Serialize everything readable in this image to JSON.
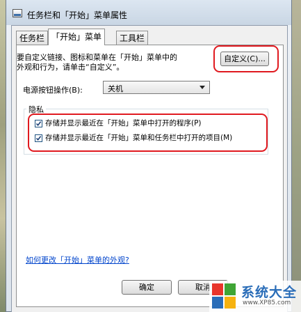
{
  "window": {
    "title": "任务栏和「开始」菜单属性"
  },
  "tabs": [
    {
      "label": "任务栏",
      "active": false
    },
    {
      "label": "「开始」菜单",
      "active": true
    },
    {
      "label": "工具栏",
      "active": false
    }
  ],
  "start_menu": {
    "description_line1": "要自定义链接、图标和菜单在「开始」菜单中的",
    "description_line2": "外观和行为，请单击“自定义”。",
    "customize_button": "自定义(C)...",
    "power_label": "电源按钮操作(B):",
    "power_value": "关机",
    "privacy_group_title": "隐私",
    "privacy_options": [
      {
        "label": "存储并显示最近在「开始」菜单中打开的程序(P)",
        "checked": true
      },
      {
        "label": "存储并显示最近在「开始」菜单和任务栏中打开的项目(M)",
        "checked": true
      }
    ],
    "help_link": "如何更改「开始」菜单的外观?"
  },
  "dialog_buttons": {
    "ok": "确定",
    "cancel": "取消"
  },
  "watermark": {
    "name": "系统大全",
    "url": "www.XP85.com",
    "colors": [
      "#e8352b",
      "#3fa535",
      "#2a6db8",
      "#f6b20f"
    ]
  },
  "highlight_color": "#e0191f"
}
